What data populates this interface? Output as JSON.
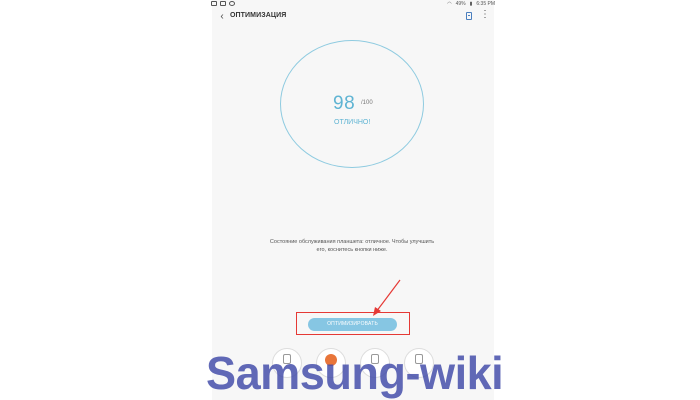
{
  "status_bar": {
    "battery_text": "49%",
    "time": "6:35 PM"
  },
  "toolbar": {
    "title": "ОПТИМИЗАЦИЯ",
    "back_icon": "back-arrow-icon",
    "report_icon": "report-icon",
    "more_icon": "more-vertical-icon"
  },
  "score": {
    "value": "98",
    "max": "/100",
    "status": "ОТЛИЧНО!"
  },
  "description": "Состояние обслуживания планшета: отличное. Чтобы улучшить его, коснитесь кнопки ниже.",
  "optimize_button": {
    "label": "ОПТИМИЗИРОВАТЬ"
  },
  "watermark": "Samsung-wiki",
  "colors": {
    "accent": "#5fb4d3",
    "button": "#86c6e3",
    "highlight": "#e53935",
    "watermark": "#3f49a8"
  }
}
